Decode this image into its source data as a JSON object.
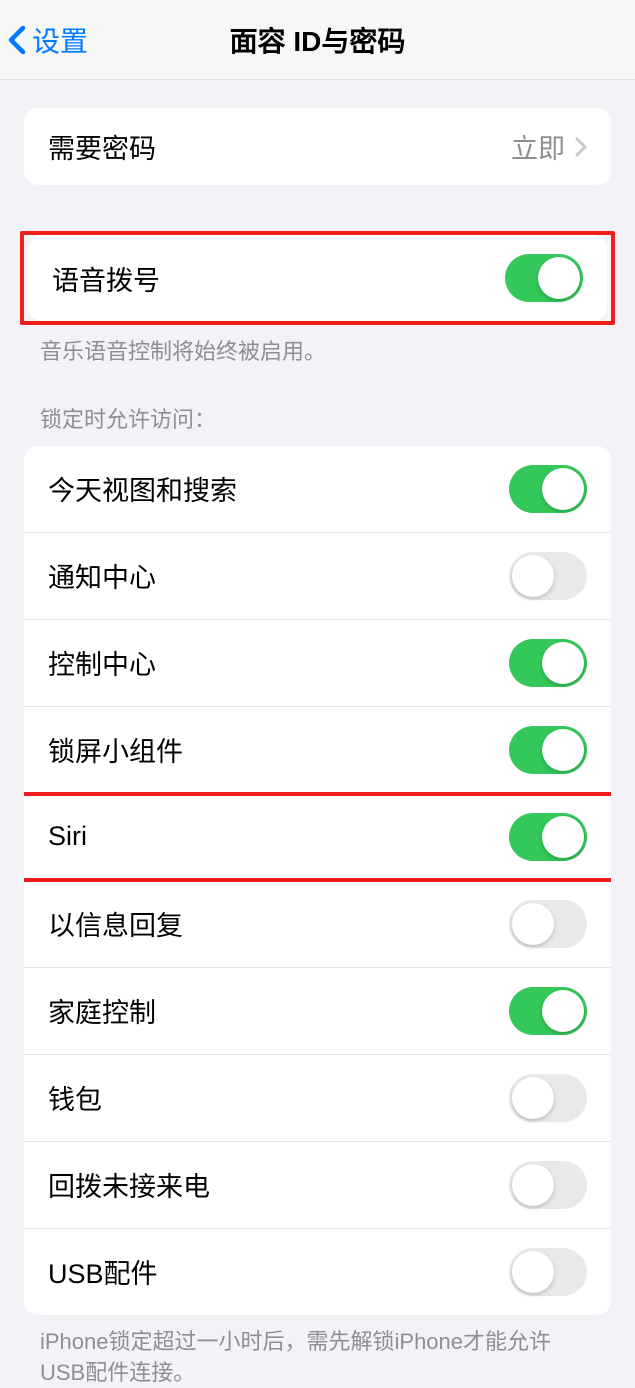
{
  "header": {
    "back_label": "设置",
    "title": "面容 ID与密码"
  },
  "require_passcode": {
    "label": "需要密码",
    "value": "立即"
  },
  "voice_dial": {
    "label": "语音拨号",
    "on": true,
    "footer": "音乐语音控制将始终被启用。"
  },
  "lock_access": {
    "header": "锁定时允许访问：",
    "items": [
      {
        "label": "今天视图和搜索",
        "on": true
      },
      {
        "label": "通知中心",
        "on": false
      },
      {
        "label": "控制中心",
        "on": true
      },
      {
        "label": "锁屏小组件",
        "on": true
      },
      {
        "label": "Siri",
        "on": true
      },
      {
        "label": "以信息回复",
        "on": false
      },
      {
        "label": "家庭控制",
        "on": true
      },
      {
        "label": "钱包",
        "on": false
      },
      {
        "label": "回拨未接来电",
        "on": false
      },
      {
        "label": "USB配件",
        "on": false
      }
    ],
    "footer": "iPhone锁定超过一小时后，需先解锁iPhone才能允许USB配件连接。"
  }
}
